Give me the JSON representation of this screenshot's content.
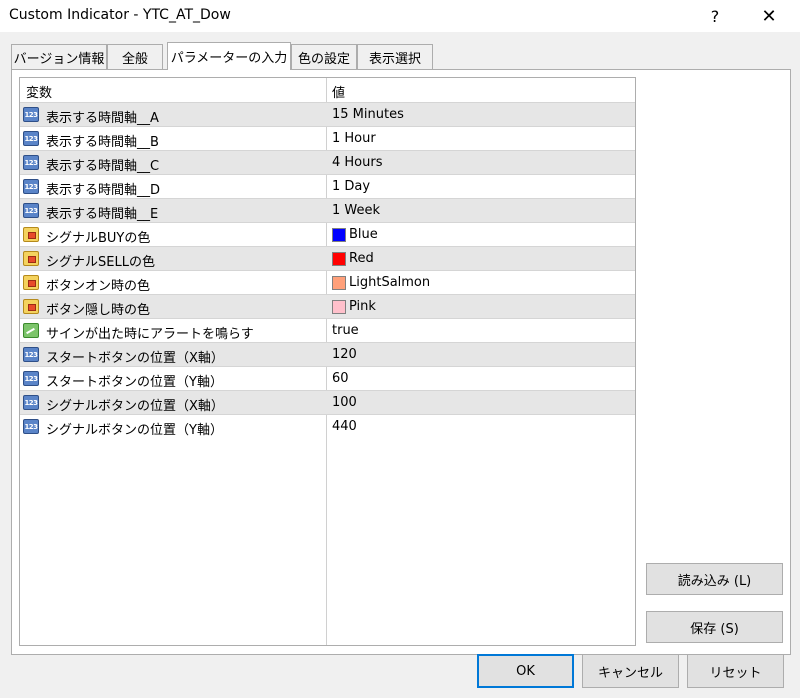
{
  "window": {
    "title": "Custom Indicator - YTC_AT_Dow",
    "help": "?",
    "close": "✕"
  },
  "tabs": [
    {
      "label": "バージョン情報"
    },
    {
      "label": "全般"
    },
    {
      "label": "パラメーターの入力"
    },
    {
      "label": "色の設定"
    },
    {
      "label": "表示選択"
    }
  ],
  "grid": {
    "header": {
      "name": "変数",
      "value": "値"
    },
    "rows": [
      {
        "name": "表示する時間軸__A",
        "value": "15 Minutes",
        "icon": "number-icon"
      },
      {
        "name": "表示する時間軸__B",
        "value": "1 Hour",
        "icon": "number-icon"
      },
      {
        "name": "表示する時間軸__C",
        "value": "4 Hours",
        "icon": "number-icon"
      },
      {
        "name": "表示する時間軸__D",
        "value": "1 Day",
        "icon": "number-icon"
      },
      {
        "name": "表示する時間軸__E",
        "value": "1 Week",
        "icon": "number-icon"
      },
      {
        "name": "シグナルBUYの色",
        "value": "Blue",
        "icon": "color-icon",
        "swatch": "#0000ff"
      },
      {
        "name": "シグナルSELLの色",
        "value": "Red",
        "icon": "color-icon",
        "swatch": "#ff0000"
      },
      {
        "name": "ボタンオン時の色",
        "value": "LightSalmon",
        "icon": "color-icon",
        "swatch": "#ffa07a"
      },
      {
        "name": "ボタン隠し時の色",
        "value": "Pink",
        "icon": "color-icon",
        "swatch": "#ffc0cb"
      },
      {
        "name": "サインが出た時にアラートを鳴らす",
        "value": "true",
        "icon": "bool-icon"
      },
      {
        "name": "スタートボタンの位置（X軸）",
        "value": "120",
        "icon": "number-icon"
      },
      {
        "name": "スタートボタンの位置（Y軸）",
        "value": "60",
        "icon": "number-icon"
      },
      {
        "name": "シグナルボタンの位置（X軸）",
        "value": "100",
        "icon": "number-icon"
      },
      {
        "name": "シグナルボタンの位置（Y軸）",
        "value": "440",
        "icon": "number-icon"
      }
    ]
  },
  "side_buttons": {
    "load": "読み込み (L)",
    "save": "保存 (S)"
  },
  "footer_buttons": {
    "ok": "OK",
    "cancel": "キャンセル",
    "reset": "リセット"
  },
  "icon_text": {
    "number": "123"
  }
}
